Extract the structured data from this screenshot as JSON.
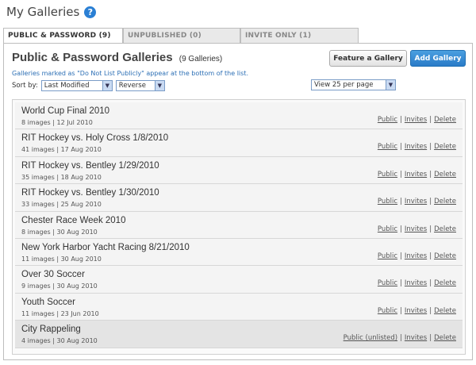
{
  "page": {
    "title": "My Galleries"
  },
  "tabs": [
    {
      "label": "PUBLIC & PASSWORD (9)",
      "active": true
    },
    {
      "label": "UNPUBLISHED (0)",
      "active": false
    },
    {
      "label": "INVITE ONLY (1)",
      "active": false
    }
  ],
  "panel": {
    "title": "Public & Password Galleries",
    "count": "(9 Galleries)",
    "feature_button": "Feature a Gallery",
    "add_button": "Add Gallery",
    "note": "Galleries marked as \"Do Not List Publicly\" appear at the bottom of the list.",
    "sort_label": "Sort by:",
    "sort_value": "Last Modified",
    "order_value": "Reverse",
    "view_value": "View 25 per page"
  },
  "galleries": [
    {
      "title": "World Cup Final 2010",
      "meta": "8 images | 12 Jul 2010",
      "public_link": "Public",
      "invites_link": "Invites",
      "delete_link": "Delete"
    },
    {
      "title": "RIT Hockey vs. Holy Cross 1/8/2010",
      "meta": "41 images | 17 Aug 2010",
      "public_link": "Public",
      "invites_link": "Invites",
      "delete_link": "Delete"
    },
    {
      "title": "RIT Hockey vs. Bentley 1/29/2010",
      "meta": "35 images | 18 Aug 2010",
      "public_link": "Public",
      "invites_link": "Invites",
      "delete_link": "Delete"
    },
    {
      "title": "RIT Hockey vs. Bentley 1/30/2010",
      "meta": "33 images | 25 Aug 2010",
      "public_link": "Public",
      "invites_link": "Invites",
      "delete_link": "Delete"
    },
    {
      "title": "Chester Race Week 2010",
      "meta": "8 images | 30 Aug 2010",
      "public_link": "Public",
      "invites_link": "Invites",
      "delete_link": "Delete"
    },
    {
      "title": "New York Harbor Yacht Racing 8/21/2010",
      "meta": "11 images | 30 Aug 2010",
      "public_link": "Public",
      "invites_link": "Invites",
      "delete_link": "Delete"
    },
    {
      "title": "Over 30 Soccer",
      "meta": "9 images | 30 Aug 2010",
      "public_link": "Public",
      "invites_link": "Invites",
      "delete_link": "Delete"
    },
    {
      "title": "Youth Soccer",
      "meta": "11 images | 23 Jun 2010",
      "public_link": "Public",
      "invites_link": "Invites",
      "delete_link": "Delete"
    },
    {
      "title": "City Rappeling",
      "meta": "4 images | 30 Aug 2010",
      "public_link": "Public (unlisted)",
      "invites_link": "Invites",
      "delete_link": "Delete"
    }
  ],
  "separator": "|",
  "colors": {
    "accent": "#2a7bc8",
    "link": "#2c6fb5",
    "panel_border": "#bdbdbd"
  },
  "icons": {
    "help": "help-icon",
    "dropdown": "chevron-down-icon"
  }
}
